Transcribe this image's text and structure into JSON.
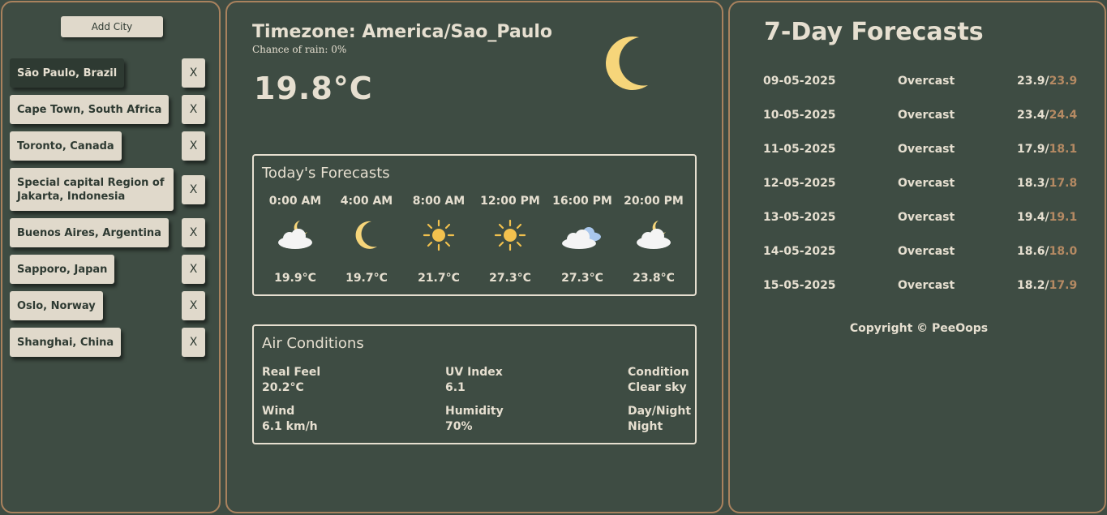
{
  "sidebar": {
    "add_city_label": "Add City",
    "remove_label": "X",
    "cities": [
      {
        "name": "São Paulo, Brazil",
        "active": true
      },
      {
        "name": "Cape Town, South Africa",
        "active": false
      },
      {
        "name": "Toronto, Canada",
        "active": false
      },
      {
        "name": "Special capital Region of Jakarta, Indonesia",
        "active": false
      },
      {
        "name": "Buenos Aires, Argentina",
        "active": false
      },
      {
        "name": "Sapporo, Japan",
        "active": false
      },
      {
        "name": "Oslo, Norway",
        "active": false
      },
      {
        "name": "Shanghai, China",
        "active": false
      }
    ]
  },
  "current": {
    "timezone": "Timezone: America/Sao_Paulo",
    "rain": "Chance of rain: 0%",
    "temperature": "19.8°C",
    "icon": "crescent-moon-icon"
  },
  "today": {
    "title": "Today's Forecasts",
    "hours": [
      {
        "time": "0:00 AM",
        "icon": "cloud-moon-icon",
        "temp": "19.9°C"
      },
      {
        "time": "4:00 AM",
        "icon": "crescent-moon-icon",
        "temp": "19.7°C"
      },
      {
        "time": "8:00 AM",
        "icon": "sun-icon",
        "temp": "21.7°C"
      },
      {
        "time": "12:00 PM",
        "icon": "sun-icon",
        "temp": "27.3°C"
      },
      {
        "time": "16:00 PM",
        "icon": "clouds-icon",
        "temp": "27.3°C"
      },
      {
        "time": "20:00 PM",
        "icon": "cloud-moon-icon",
        "temp": "23.8°C"
      }
    ]
  },
  "air": {
    "title": "Air Conditions",
    "real_feel_label": "Real Feel",
    "real_feel": "20.2°C",
    "uv_label": "UV Index",
    "uv": "6.1",
    "condition_label": "Condition",
    "condition": "Clear sky",
    "wind_label": "Wind",
    "wind": "6.1 km/h",
    "humidity_label": "Humidity",
    "humidity": "70%",
    "daynight_label": "Day/Night",
    "daynight": "Night"
  },
  "week": {
    "title": "7-Day Forecasts",
    "days": [
      {
        "date": "09-05-2025",
        "condition": "Overcast",
        "high": "23.9/",
        "low": "23.9"
      },
      {
        "date": "10-05-2025",
        "condition": "Overcast",
        "high": "23.4/",
        "low": "24.4"
      },
      {
        "date": "11-05-2025",
        "condition": "Overcast",
        "high": "17.9/",
        "low": "18.1"
      },
      {
        "date": "12-05-2025",
        "condition": "Overcast",
        "high": "18.3/",
        "low": "17.8"
      },
      {
        "date": "13-05-2025",
        "condition": "Overcast",
        "high": "19.4/",
        "low": "19.1"
      },
      {
        "date": "14-05-2025",
        "condition": "Overcast",
        "high": "18.6/",
        "low": "18.0"
      },
      {
        "date": "15-05-2025",
        "condition": "Overcast",
        "high": "18.2/",
        "low": "17.9"
      }
    ],
    "copyright": "Copyright © PeeOops"
  },
  "colors": {
    "background": "#3e4c43",
    "border": "#a9825e",
    "button": "#e0d9cb",
    "accent_low": "#b58a63",
    "moon": "#f6d57a",
    "sun": "#f2c14e"
  }
}
